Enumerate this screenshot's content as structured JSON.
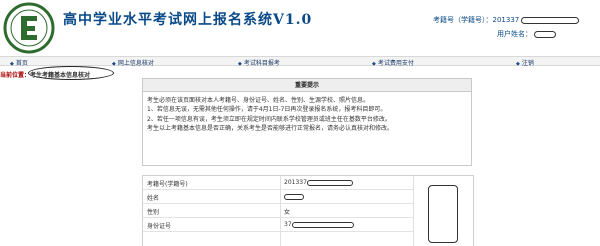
{
  "header": {
    "title": "高中学业水平考试网上报名系统V1.0",
    "exam_id_label": "考籍号（学籍号）：",
    "exam_id_value": "201337",
    "user_name_label": "用户姓名："
  },
  "nav": [
    {
      "label": "首页"
    },
    {
      "label": "网上信息核对"
    },
    {
      "label": "考试科目报考"
    },
    {
      "label": "考试费用支付"
    },
    {
      "label": "注销"
    }
  ],
  "breadcrumb": {
    "label": "当前位置：",
    "current": "考生考籍基本信息核对"
  },
  "notice": {
    "title": "重要提示",
    "lines": [
      "考生必须在该页面核对本人考籍号、身份证号、姓名、性别、生源学校、照片信息。",
      "1、若信息无误，无需其他任何操作，请于4月1日-7日再次登录报名系统，报考科目即可。",
      "2、若任一项信息有误，考生须立即在规定时间内联系学校管理员或班主任在基数平台修改。",
      "考生以上考籍基本信息是否正确，关系考生是否能够进行正常报名，请务必认真核对和修改。"
    ]
  },
  "info_table": [
    {
      "label": "考籍号(学籍号)",
      "value": "201337"
    },
    {
      "label": "姓名",
      "value": ""
    },
    {
      "label": "性别",
      "value": "女"
    },
    {
      "label": "身份证号",
      "value": "37"
    }
  ],
  "colors": {
    "title": "#0a4a88",
    "breadcrumb": "#aa0000",
    "nav_bg": "#f3f3f3"
  }
}
